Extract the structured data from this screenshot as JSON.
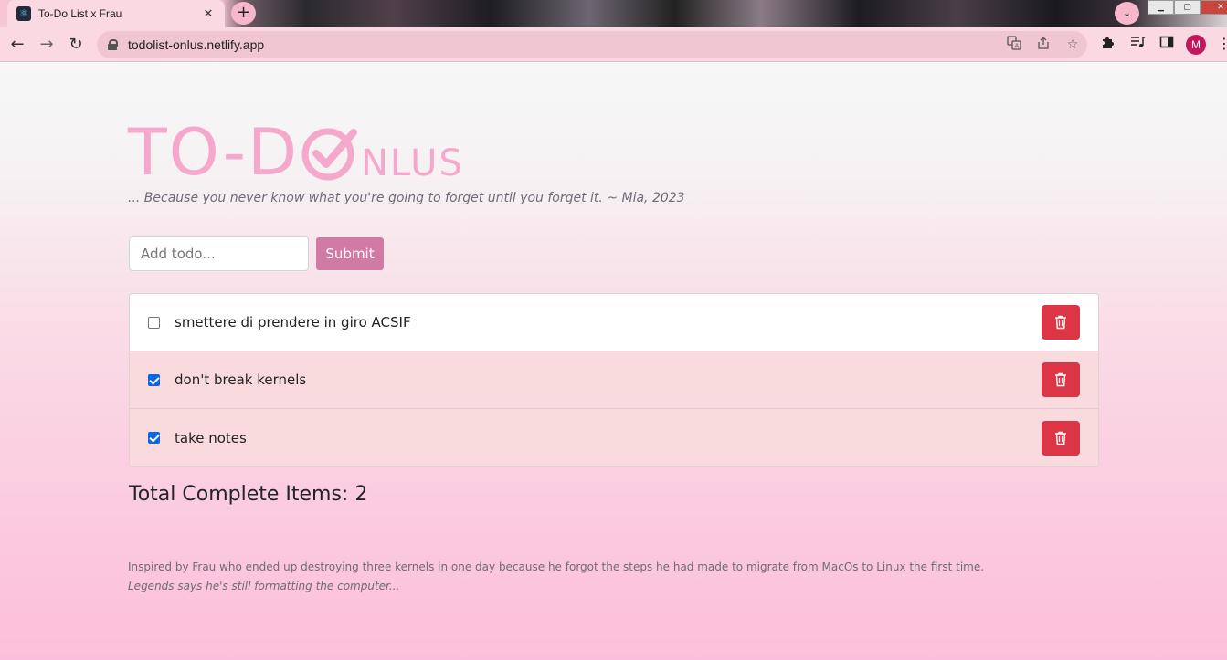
{
  "browser": {
    "tab_title": "To-Do List x Frau",
    "tab_close": "✕",
    "new_tab": "+",
    "tab_search": "⌄",
    "url": "todolist-onlus.netlify.app",
    "avatar_letter": "M",
    "back": "←",
    "forward": "→",
    "reload": "↻"
  },
  "logo": {
    "big_text": "TO-D",
    "small_text": "NLUS",
    "color": "#f5a8cc"
  },
  "tagline": "... Because you never know what you're going to forget until you forget it. ~ Mia, 2023",
  "form": {
    "placeholder": "Add todo...",
    "submit_label": "Submit"
  },
  "todos": [
    {
      "text": "smettere di prendere in giro ACSIF",
      "checked": false
    },
    {
      "text": "don't break kernels",
      "checked": true
    },
    {
      "text": "take notes",
      "checked": true
    }
  ],
  "total_label": "Total Complete Items: 2",
  "footer": {
    "line1": "Inspired by Frau who ended up destroying three kernels in one day because he forgot the steps he had made to migrate from MacOs to Linux the first time.",
    "line2": "Legends says he's still formatting the computer..."
  },
  "colors": {
    "delete_button": "#dc3545",
    "submit_button": "#d17aa3",
    "checkbox_checked": "#0a66e4"
  }
}
